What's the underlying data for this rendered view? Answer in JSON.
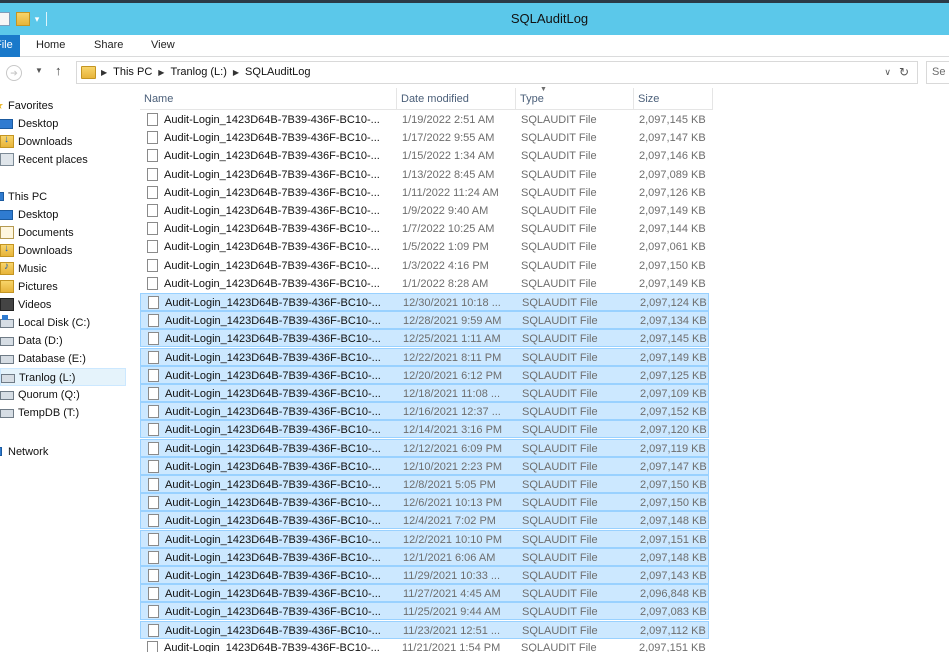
{
  "window": {
    "title": "SQLAuditLog",
    "qat_dropdown": "▾"
  },
  "ribbon": {
    "tabs": {
      "file": "File",
      "home": "Home",
      "share": "Share",
      "view": "View"
    }
  },
  "address": {
    "crumbs": [
      "This PC",
      "Tranlog (L:)",
      "SQLAuditLog"
    ],
    "search_placeholder": "Se"
  },
  "nav": {
    "favorites": {
      "header": "Favorites",
      "items": [
        "Desktop",
        "Downloads",
        "Recent places"
      ]
    },
    "this_pc": {
      "header": "This PC",
      "items": [
        "Desktop",
        "Documents",
        "Downloads",
        "Music",
        "Pictures",
        "Videos",
        "Local Disk (C:)",
        "Data (D:)",
        "Database (E:)",
        "Tranlog (L:)",
        "Quorum (Q:)",
        "TempDB (T:)"
      ]
    },
    "network": {
      "header": "Network"
    },
    "selected_item": "Tranlog (L:)"
  },
  "columns": {
    "name": "Name",
    "date": "Date modified",
    "type": "Type",
    "size": "Size"
  },
  "files": [
    {
      "name": "Audit-Login_1423D64B-7B39-436F-BC10-...",
      "date": "1/19/2022 2:51 AM",
      "type": "SQLAUDIT File",
      "size": "2,097,145 KB",
      "selected": false
    },
    {
      "name": "Audit-Login_1423D64B-7B39-436F-BC10-...",
      "date": "1/17/2022 9:55 AM",
      "type": "SQLAUDIT File",
      "size": "2,097,147 KB",
      "selected": false
    },
    {
      "name": "Audit-Login_1423D64B-7B39-436F-BC10-...",
      "date": "1/15/2022 1:34 AM",
      "type": "SQLAUDIT File",
      "size": "2,097,146 KB",
      "selected": false
    },
    {
      "name": "Audit-Login_1423D64B-7B39-436F-BC10-...",
      "date": "1/13/2022 8:45 AM",
      "type": "SQLAUDIT File",
      "size": "2,097,089 KB",
      "selected": false
    },
    {
      "name": "Audit-Login_1423D64B-7B39-436F-BC10-...",
      "date": "1/11/2022 11:24 AM",
      "type": "SQLAUDIT File",
      "size": "2,097,126 KB",
      "selected": false
    },
    {
      "name": "Audit-Login_1423D64B-7B39-436F-BC10-...",
      "date": "1/9/2022 9:40 AM",
      "type": "SQLAUDIT File",
      "size": "2,097,149 KB",
      "selected": false
    },
    {
      "name": "Audit-Login_1423D64B-7B39-436F-BC10-...",
      "date": "1/7/2022 10:25 AM",
      "type": "SQLAUDIT File",
      "size": "2,097,144 KB",
      "selected": false
    },
    {
      "name": "Audit-Login_1423D64B-7B39-436F-BC10-...",
      "date": "1/5/2022 1:09 PM",
      "type": "SQLAUDIT File",
      "size": "2,097,061 KB",
      "selected": false
    },
    {
      "name": "Audit-Login_1423D64B-7B39-436F-BC10-...",
      "date": "1/3/2022 4:16 PM",
      "type": "SQLAUDIT File",
      "size": "2,097,150 KB",
      "selected": false
    },
    {
      "name": "Audit-Login_1423D64B-7B39-436F-BC10-...",
      "date": "1/1/2022 8:28 AM",
      "type": "SQLAUDIT File",
      "size": "2,097,149 KB",
      "selected": false
    },
    {
      "name": "Audit-Login_1423D64B-7B39-436F-BC10-...",
      "date": "12/30/2021 10:18 ...",
      "type": "SQLAUDIT File",
      "size": "2,097,124 KB",
      "selected": true
    },
    {
      "name": "Audit-Login_1423D64B-7B39-436F-BC10-...",
      "date": "12/28/2021 9:59 AM",
      "type": "SQLAUDIT File",
      "size": "2,097,134 KB",
      "selected": true
    },
    {
      "name": "Audit-Login_1423D64B-7B39-436F-BC10-...",
      "date": "12/25/2021 1:11 AM",
      "type": "SQLAUDIT File",
      "size": "2,097,145 KB",
      "selected": true
    },
    {
      "name": "Audit-Login_1423D64B-7B39-436F-BC10-...",
      "date": "12/22/2021 8:11 PM",
      "type": "SQLAUDIT File",
      "size": "2,097,149 KB",
      "selected": true
    },
    {
      "name": "Audit-Login_1423D64B-7B39-436F-BC10-...",
      "date": "12/20/2021 6:12 PM",
      "type": "SQLAUDIT File",
      "size": "2,097,125 KB",
      "selected": true
    },
    {
      "name": "Audit-Login_1423D64B-7B39-436F-BC10-...",
      "date": "12/18/2021 11:08 ...",
      "type": "SQLAUDIT File",
      "size": "2,097,109 KB",
      "selected": true
    },
    {
      "name": "Audit-Login_1423D64B-7B39-436F-BC10-...",
      "date": "12/16/2021 12:37 ...",
      "type": "SQLAUDIT File",
      "size": "2,097,152 KB",
      "selected": true
    },
    {
      "name": "Audit-Login_1423D64B-7B39-436F-BC10-...",
      "date": "12/14/2021 3:16 PM",
      "type": "SQLAUDIT File",
      "size": "2,097,120 KB",
      "selected": true
    },
    {
      "name": "Audit-Login_1423D64B-7B39-436F-BC10-...",
      "date": "12/12/2021 6:09 PM",
      "type": "SQLAUDIT File",
      "size": "2,097,119 KB",
      "selected": true
    },
    {
      "name": "Audit-Login_1423D64B-7B39-436F-BC10-...",
      "date": "12/10/2021 2:23 PM",
      "type": "SQLAUDIT File",
      "size": "2,097,147 KB",
      "selected": true
    },
    {
      "name": "Audit-Login_1423D64B-7B39-436F-BC10-...",
      "date": "12/8/2021 5:05 PM",
      "type": "SQLAUDIT File",
      "size": "2,097,150 KB",
      "selected": true
    },
    {
      "name": "Audit-Login_1423D64B-7B39-436F-BC10-...",
      "date": "12/6/2021 10:13 PM",
      "type": "SQLAUDIT File",
      "size": "2,097,150 KB",
      "selected": true
    },
    {
      "name": "Audit-Login_1423D64B-7B39-436F-BC10-...",
      "date": "12/4/2021 7:02 PM",
      "type": "SQLAUDIT File",
      "size": "2,097,148 KB",
      "selected": true
    },
    {
      "name": "Audit-Login_1423D64B-7B39-436F-BC10-...",
      "date": "12/2/2021 10:10 PM",
      "type": "SQLAUDIT File",
      "size": "2,097,151 KB",
      "selected": true
    },
    {
      "name": "Audit-Login_1423D64B-7B39-436F-BC10-...",
      "date": "12/1/2021 6:06 AM",
      "type": "SQLAUDIT File",
      "size": "2,097,148 KB",
      "selected": true
    },
    {
      "name": "Audit-Login_1423D64B-7B39-436F-BC10-...",
      "date": "11/29/2021 10:33 ...",
      "type": "SQLAUDIT File",
      "size": "2,097,143 KB",
      "selected": true
    },
    {
      "name": "Audit-Login_1423D64B-7B39-436F-BC10-...",
      "date": "11/27/2021 4:45 AM",
      "type": "SQLAUDIT File",
      "size": "2,096,848 KB",
      "selected": true
    },
    {
      "name": "Audit-Login_1423D64B-7B39-436F-BC10-...",
      "date": "11/25/2021 9:44 AM",
      "type": "SQLAUDIT File",
      "size": "2,097,083 KB",
      "selected": true
    },
    {
      "name": "Audit-Login_1423D64B-7B39-436F-BC10-...",
      "date": "11/23/2021 12:51 ...",
      "type": "SQLAUDIT File",
      "size": "2,097,112 KB",
      "selected": true
    },
    {
      "name": "Audit-Login_1423D64B-7B39-436F-BC10-...",
      "date": "11/21/2021 1:54 PM",
      "type": "SQLAUDIT File",
      "size": "2,097,151 KB",
      "selected": false
    }
  ],
  "colors": {
    "titlebar": "#5bc8ea",
    "selection": "#cce8ff",
    "selection_border": "#99d1ff",
    "file_tab": "#1979ca"
  }
}
